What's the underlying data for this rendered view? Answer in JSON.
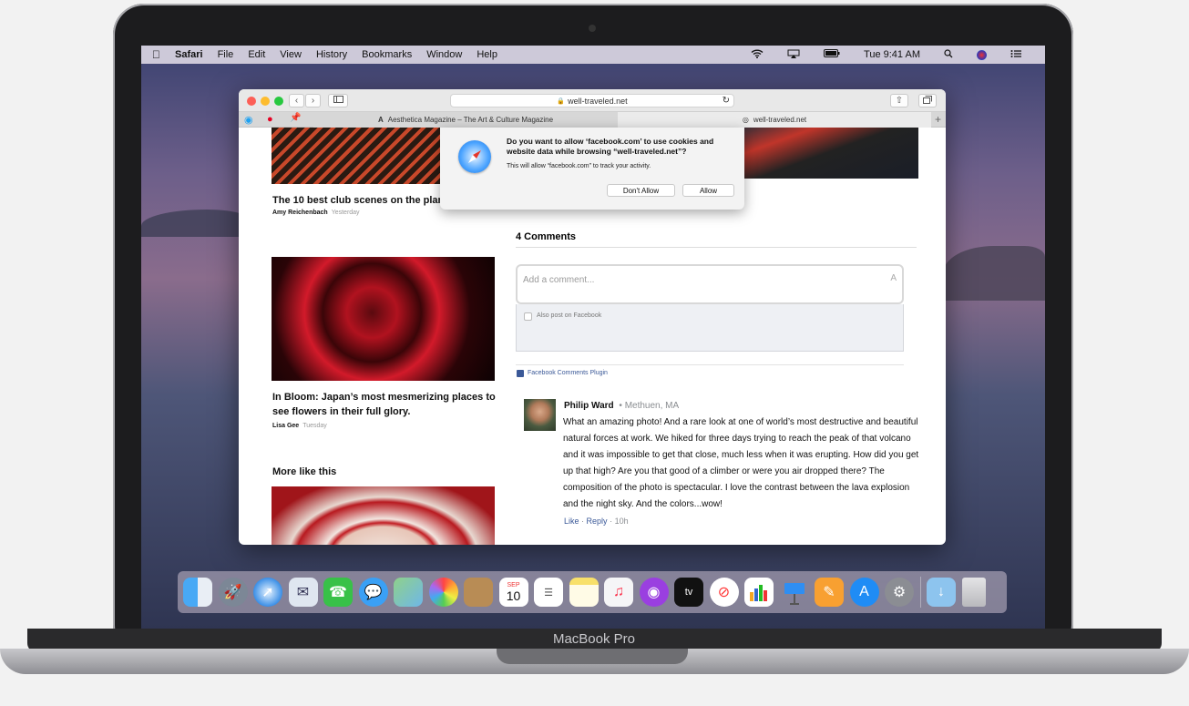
{
  "device": {
    "brand_label": "MacBook Pro"
  },
  "menubar": {
    "apple": "",
    "app_name": "Safari",
    "items": [
      "File",
      "Edit",
      "View",
      "History",
      "Bookmarks",
      "Window",
      "Help"
    ],
    "clock": "Tue 9:41 AM"
  },
  "browser": {
    "address": "well-traveled.net",
    "tabs": [
      {
        "title": "Aesthetica Magazine – The Art & Culture Magazine"
      },
      {
        "title": "well-traveled.net"
      }
    ],
    "new_tab_label": "+"
  },
  "dialog": {
    "title": "Do you want to allow ‘facebook.com’ to use cookies and website data while browsing “well-traveled.net”?",
    "message": "This will allow “facebook.com” to track your activity.",
    "deny_label": "Don't Allow",
    "allow_label": "Allow"
  },
  "articles": [
    {
      "title": "The 10 best club scenes on the plan",
      "author": "Amy Reichenbach",
      "date": "Yesterday"
    },
    {
      "title": "In Bloom: Japan’s most mesmerizing places to see flowers in their full glory.",
      "author": "Lisa Gee",
      "date": "Tuesday"
    }
  ],
  "more_like_this": "More like this",
  "comments": {
    "count_label": "4 Comments",
    "placeholder": "Add a comment...",
    "also_post_label": "Also post on Facebook",
    "plugin_label": "Facebook Comments Plugin",
    "items": [
      {
        "author": "Philip Ward",
        "location": "• Methuen, MA",
        "text": "What an amazing photo! And a rare look at one of world’s most destructive and beautiful natural forces at work. We hiked for three days trying to reach the peak of that volcano and it was impossible to get that close, much less when it was erupting. How did you get up that high? Are you that good of a climber or were you air dropped there? The composition of the photo is spectacular. I love the contrast between the lava explosion and the night sky. And the colors...wow!",
        "like_label": "Like",
        "reply_label": "Reply",
        "time": "10h"
      }
    ]
  },
  "dock": {
    "icons": [
      "finder-icon",
      "launchpad-icon",
      "safari-icon",
      "mail-icon",
      "facetime-icon",
      "messages-icon",
      "maps-icon",
      "photos-icon",
      "contacts-icon",
      "calendar-icon",
      "reminders-icon",
      "notes-icon",
      "music-icon",
      "podcasts-icon",
      "tv-icon",
      "news-icon",
      "numbers-icon",
      "keynote-icon",
      "pages-icon",
      "app-store-icon",
      "system-preferences-icon",
      "downloads-folder-icon",
      "trash-icon"
    ],
    "calendar_month": "SEP",
    "calendar_day": "10",
    "tv_label": "tv"
  },
  "colors": {
    "link": "#3b5998",
    "accent_blue": "#2d7bf4"
  }
}
